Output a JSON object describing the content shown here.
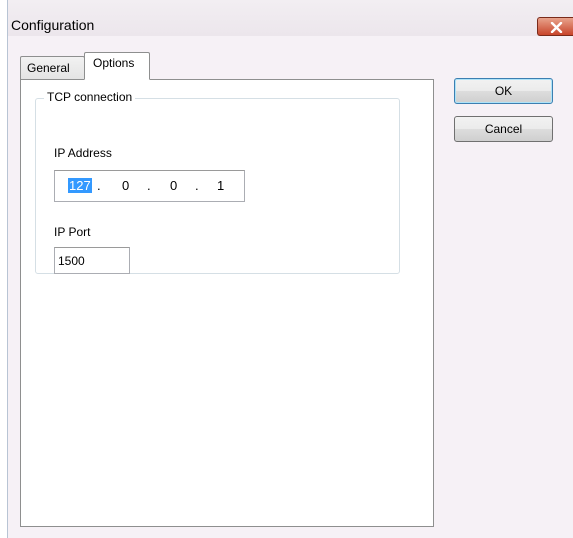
{
  "window": {
    "title": "Configuration"
  },
  "tabs": [
    {
      "label": "General",
      "selected": false
    },
    {
      "label": "Options",
      "selected": true
    }
  ],
  "tcp_group": {
    "legend": "TCP connection",
    "ip_address_label": "IP Address",
    "ip_octets": [
      "127",
      "0",
      "0",
      "1"
    ],
    "ip_separator": ".",
    "ip_port_label": "IP Port",
    "ip_port_value": "1500"
  },
  "buttons": {
    "ok_label": "OK",
    "cancel_label": "Cancel"
  },
  "colors": {
    "selection": "#3399ff",
    "close_button": "#c8452b"
  },
  "icons": {
    "close": "close-icon"
  }
}
